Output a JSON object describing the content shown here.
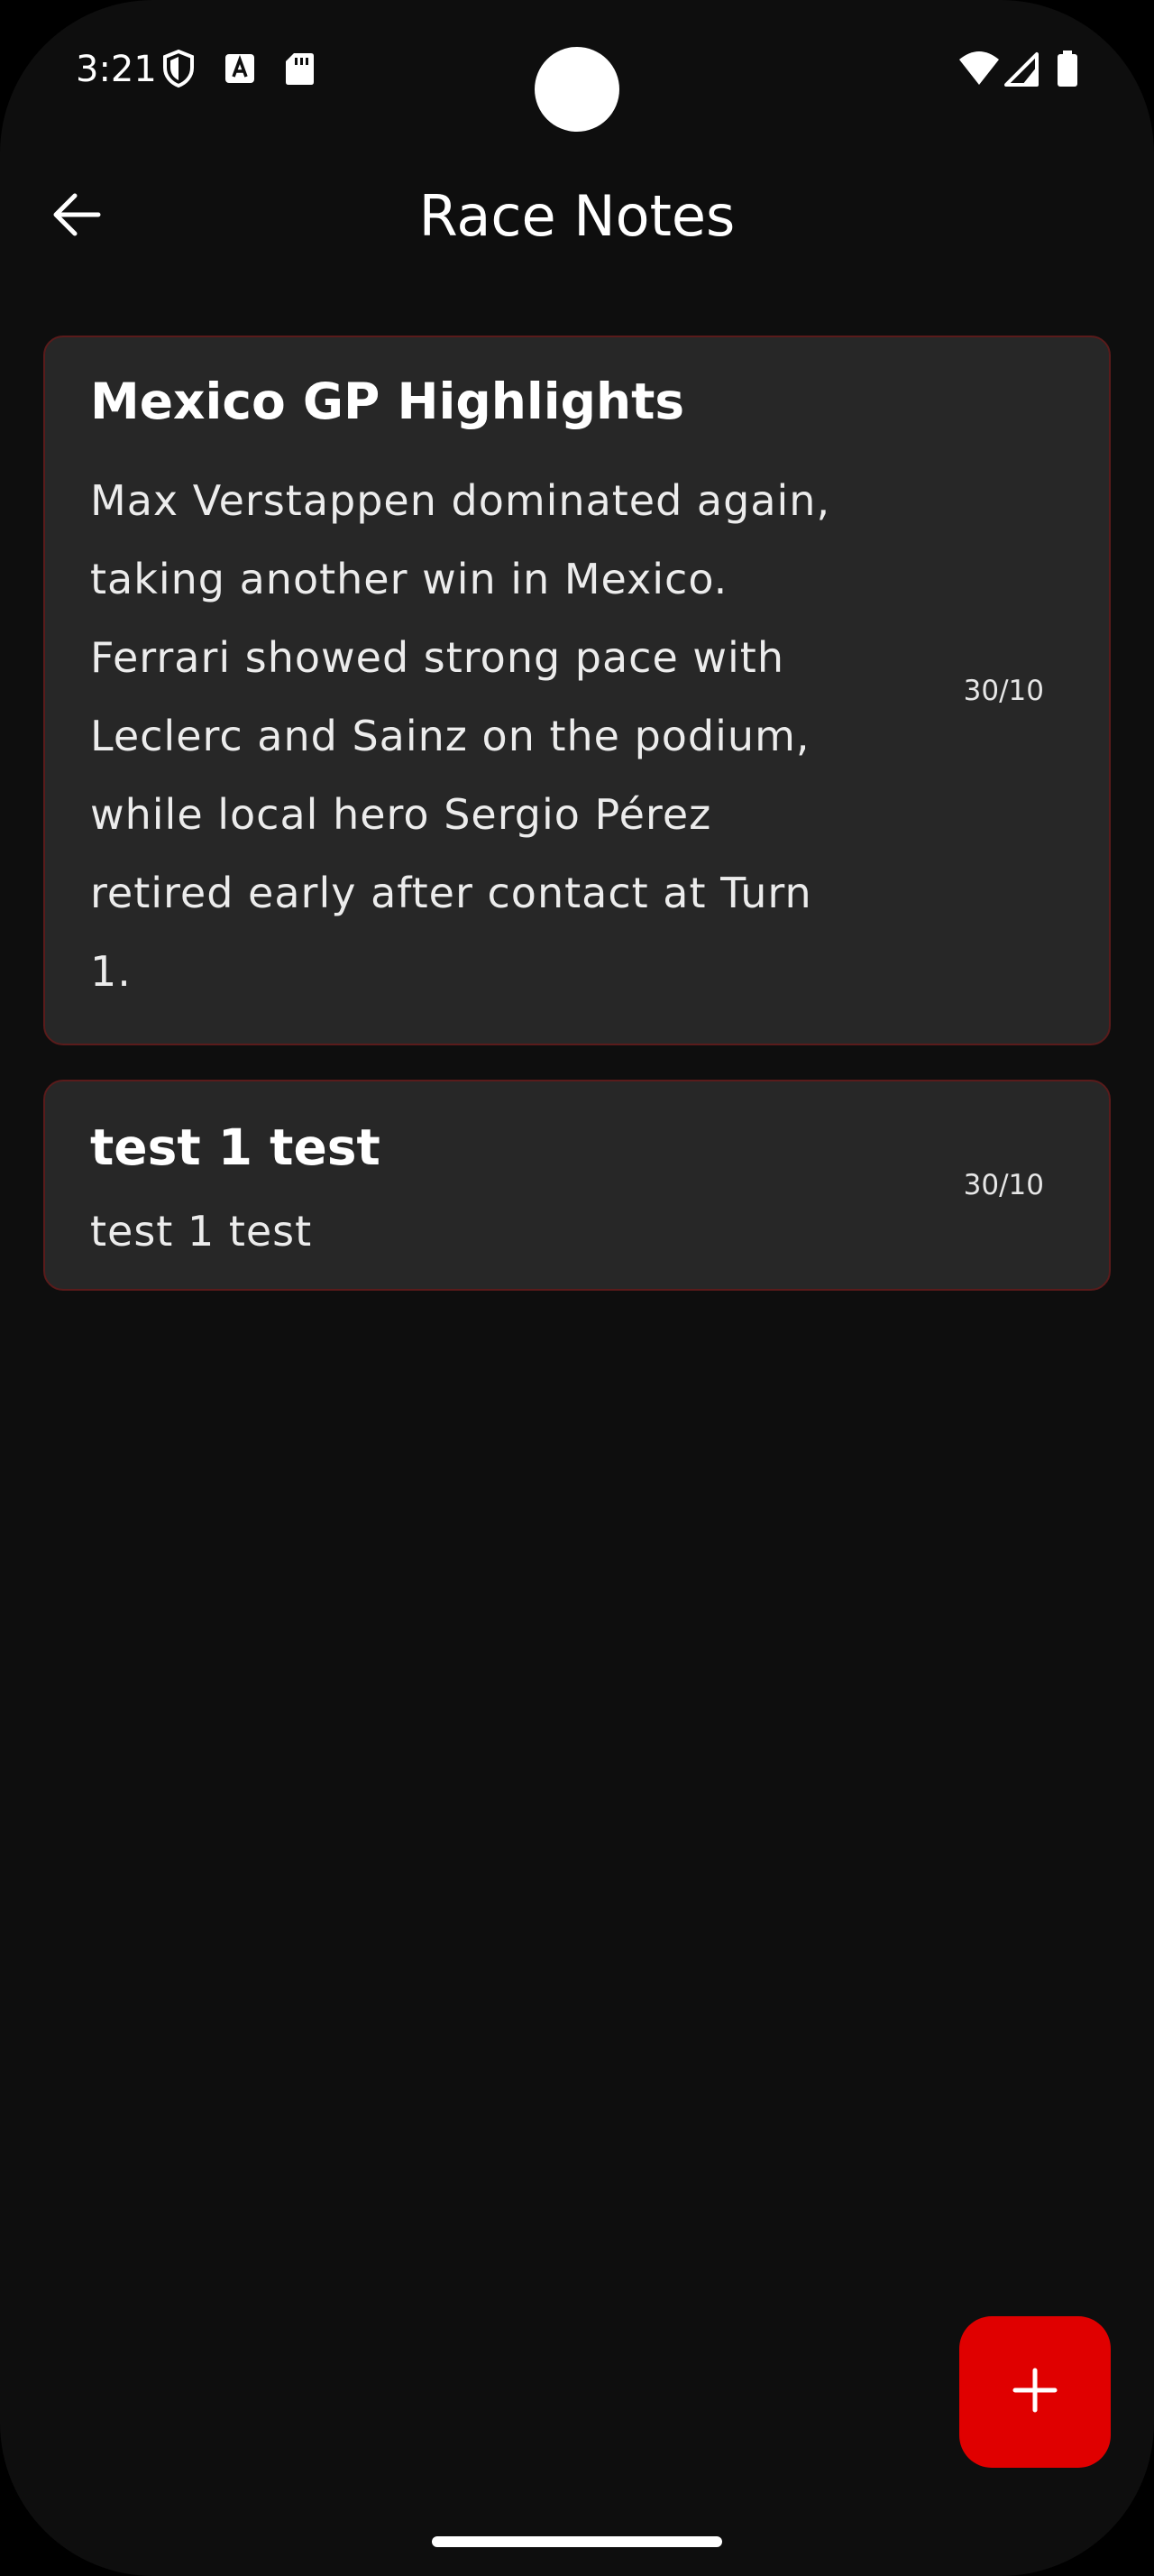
{
  "status_bar": {
    "time": "3:21",
    "icons_left": [
      "shield-icon",
      "font-a-icon",
      "sd-card-icon"
    ],
    "icons_right": [
      "wifi-icon",
      "cell-signal-icon",
      "battery-icon"
    ]
  },
  "app_bar": {
    "title": "Race Notes",
    "back_icon": "arrow-left-icon"
  },
  "notes": [
    {
      "title": "Mexico GP Highlights",
      "body": "Max Verstappen dominated again, taking another win in Mexico. Ferrari showed strong pace with Leclerc and Sainz on the podium, while local hero Sergio Pérez retired early after contact at Turn 1.",
      "date": "30/10"
    },
    {
      "title": "test 1 test",
      "body": "test 1 test",
      "date": "30/10"
    }
  ],
  "fab": {
    "icon": "plus-icon"
  },
  "colors": {
    "background": "#0e0e0e",
    "card": "#272727",
    "card_border": "#5a1b1b",
    "accent": "#e00000",
    "text": "#ffffff"
  }
}
